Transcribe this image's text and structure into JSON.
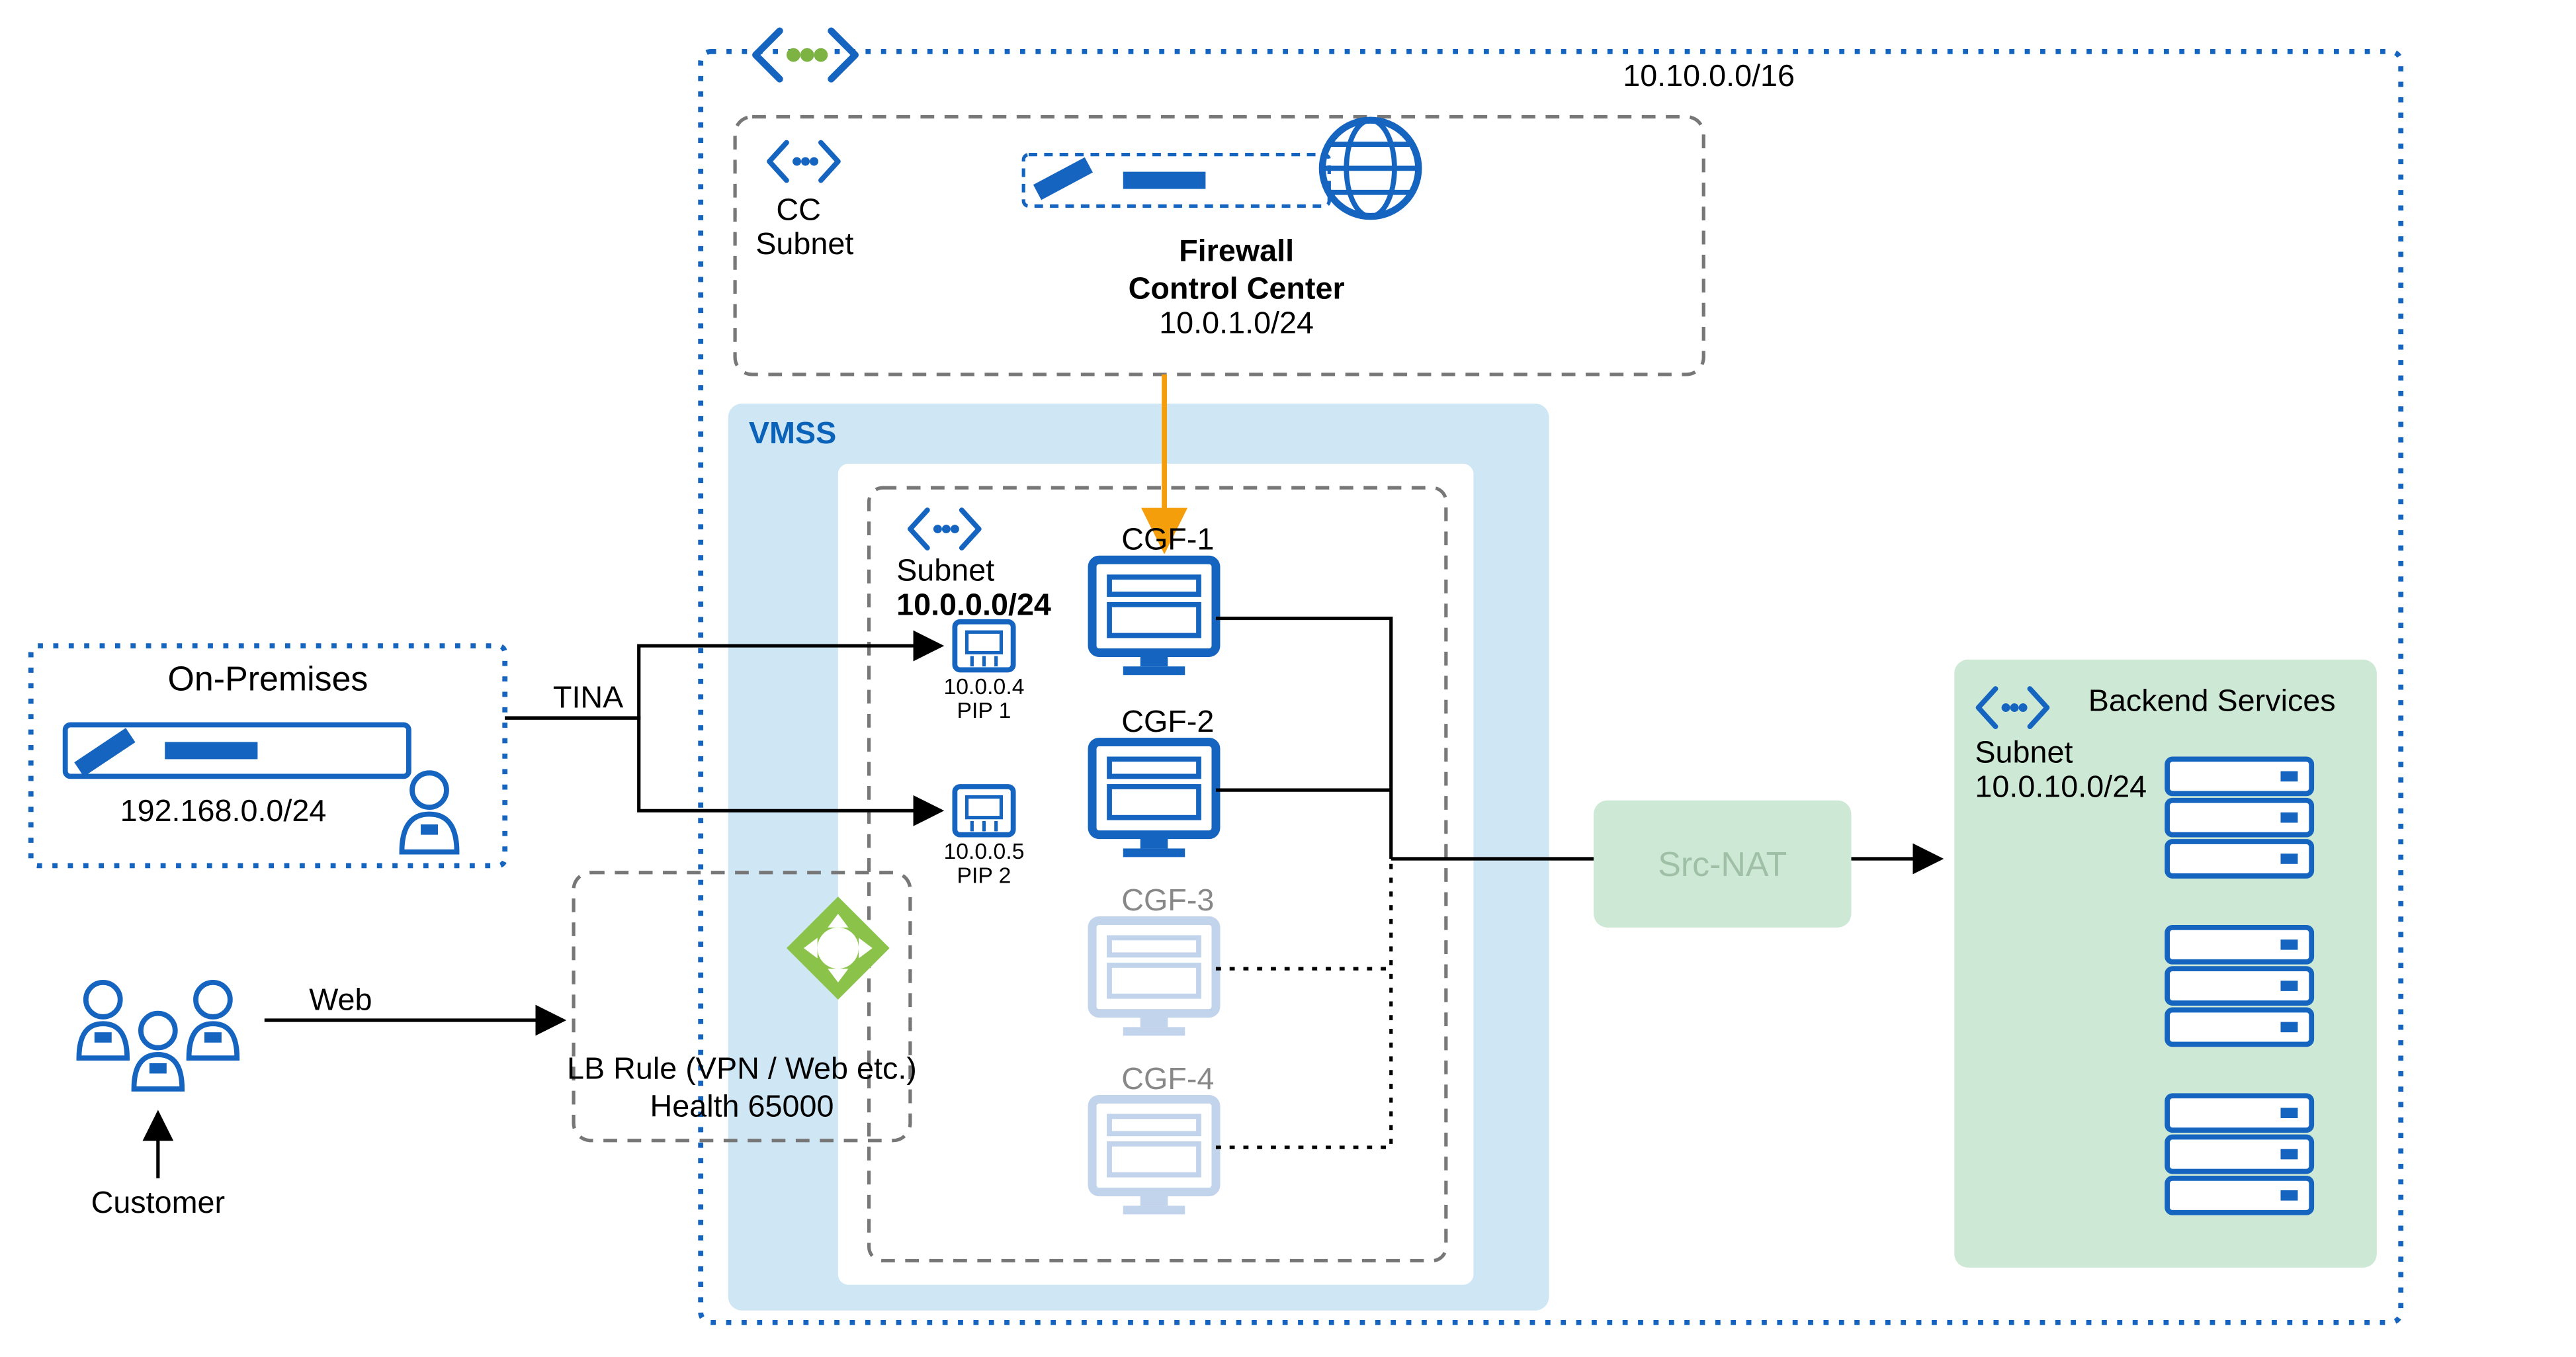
{
  "vnet_cidr": "10.10.0.0/16",
  "cc": {
    "subnet_label": "CC\nSubnet",
    "title1": "Firewall",
    "title2": "Control Center",
    "cidr": "10.0.1.0/24"
  },
  "vmss": {
    "label": "VMSS",
    "subnet_label": "Subnet",
    "subnet_cidr": "10.0.0.0/24",
    "cgf": [
      {
        "name": "CGF-1",
        "ip": "10.0.0.4",
        "pip": "PIP 1",
        "active": true
      },
      {
        "name": "CGF-2",
        "ip": "10.0.0.5",
        "pip": "PIP 2",
        "active": true
      },
      {
        "name": "CGF-3",
        "active": false
      },
      {
        "name": "CGF-4",
        "active": false
      }
    ]
  },
  "onprem": {
    "title": "On-Premises",
    "cidr": "192.168.0.0/24"
  },
  "links": {
    "tina": "TINA",
    "web": "Web",
    "customer": "Customer"
  },
  "lb": {
    "line1": "LB Rule (VPN / Web etc.)",
    "line2": "Health 65000"
  },
  "nat": "Src-NAT",
  "backend": {
    "subnet_label": "Subnet",
    "title": "Backend Services",
    "cidr": "10.0.10.0/24"
  }
}
